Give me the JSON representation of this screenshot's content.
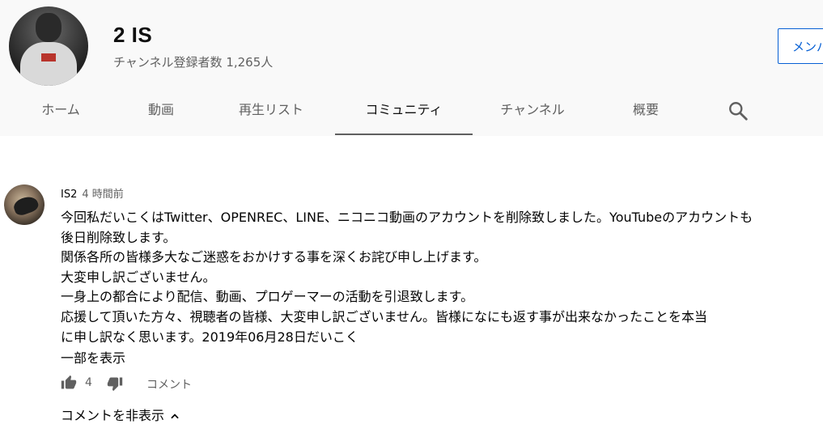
{
  "channel": {
    "name": "2 IS",
    "subscribers": "チャンネル登録者数 1,265人",
    "member_button": "メンバ"
  },
  "tabs": [
    {
      "label": "ホーム",
      "active": false
    },
    {
      "label": "動画",
      "active": false
    },
    {
      "label": "再生リスト",
      "active": false
    },
    {
      "label": "コミュニティ",
      "active": true
    },
    {
      "label": "チャンネル",
      "active": false
    },
    {
      "label": "概要",
      "active": false
    }
  ],
  "post": {
    "author": "IS2",
    "time": "4 時間前",
    "lines": [
      "今回私だいこくはTwitter、OPENREC、LINE、ニコニコ動画のアカウントを削除致しました。YouTubeのアカウントも",
      "後日削除致します。",
      "関係各所の皆様多大なご迷惑をおかけする事を深くお詫び申し上げます。",
      "大変申し訳ございません。",
      "一身上の都合により配信、動画、プロゲーマーの活動を引退致します。",
      "応援して頂いた方々、視聴者の皆様、大変申し訳ございません。皆様になにも返す事が出来なかったことを本当",
      "に申し訳なく思います。2019年06月28日だいこく"
    ],
    "show_more": "一部を表示",
    "like_count": "4",
    "comment_label": "コメント",
    "hide_comments": "コメントを非表示"
  },
  "icons": {
    "search": "search-icon",
    "like": "thumb-up-icon",
    "dislike": "thumb-down-icon",
    "chevron": "chevron-up-icon"
  },
  "colors": {
    "header_bg": "#f9f9f9",
    "accent": "#065fd4",
    "secondary_text": "#606060"
  }
}
